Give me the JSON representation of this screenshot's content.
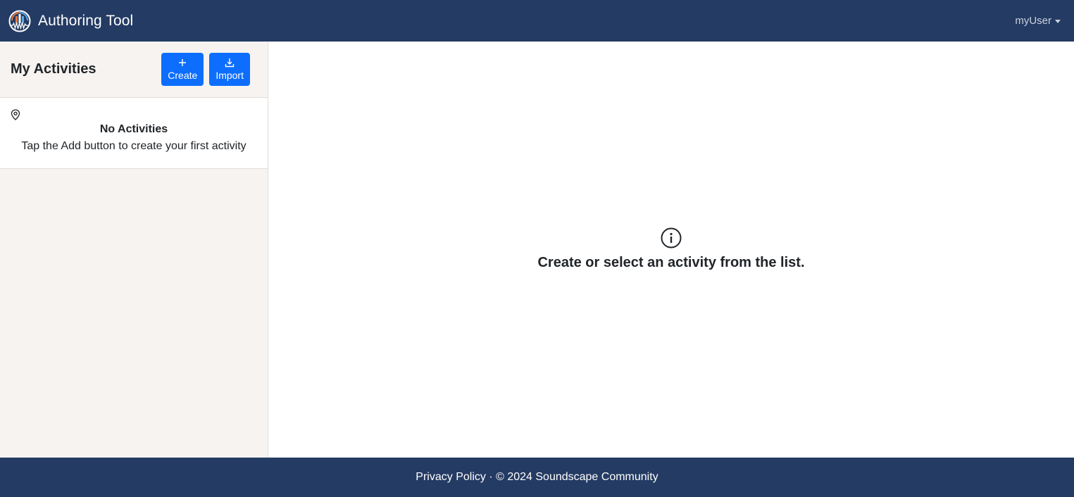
{
  "navbar": {
    "title": "Authoring Tool",
    "user": "myUser",
    "logo_icon": "soundscape-logo-icon",
    "colors": {
      "background": "#243b63"
    }
  },
  "sidebar": {
    "title": "My Activities",
    "create_label": "Create",
    "create_icon": "plus-icon",
    "import_label": "Import",
    "import_icon": "download-icon",
    "empty_icon": "map-pin-icon",
    "empty_title": "No Activities",
    "empty_text": "Tap the Add button to create your first activity",
    "colors": {
      "button": "#0d6efd",
      "background": "#f6f3f1"
    }
  },
  "main": {
    "icon": "info-circle-icon",
    "message": "Create or select an activity from the list."
  },
  "footer": {
    "privacy_link": "Privacy Policy",
    "separator": " · ",
    "copyright": "© 2024 Soundscape Community"
  }
}
